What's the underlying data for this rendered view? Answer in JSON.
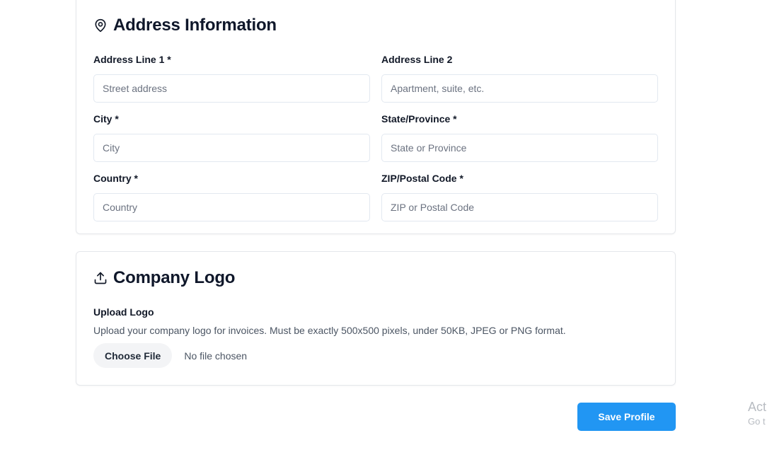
{
  "address_section": {
    "title": "Address Information",
    "icon": "map-pin-icon",
    "fields": {
      "address_line_1": {
        "label": "Address Line 1 *",
        "placeholder": "Street address",
        "value": ""
      },
      "address_line_2": {
        "label": "Address Line 2",
        "placeholder": "Apartment, suite, etc.",
        "value": ""
      },
      "city": {
        "label": "City *",
        "placeholder": "City",
        "value": ""
      },
      "state": {
        "label": "State/Province *",
        "placeholder": "State or Province",
        "value": ""
      },
      "country": {
        "label": "Country *",
        "placeholder": "Country",
        "value": ""
      },
      "zip": {
        "label": "ZIP/Postal Code *",
        "placeholder": "ZIP or Postal Code",
        "value": ""
      }
    }
  },
  "logo_section": {
    "title": "Company Logo",
    "icon": "upload-icon",
    "upload_label": "Upload Logo",
    "description": "Upload your company logo for invoices. Must be exactly 500x500 pixels, under 50KB, JPEG or PNG format.",
    "choose_file_label": "Choose File",
    "file_status": "No file chosen"
  },
  "actions": {
    "save_label": "Save Profile"
  },
  "watermark": {
    "line1": "Act",
    "line2": "Go t"
  },
  "colors": {
    "primary": "#2196f3",
    "border": "#e5e7eb",
    "text": "#111827",
    "muted": "#6b7280"
  }
}
